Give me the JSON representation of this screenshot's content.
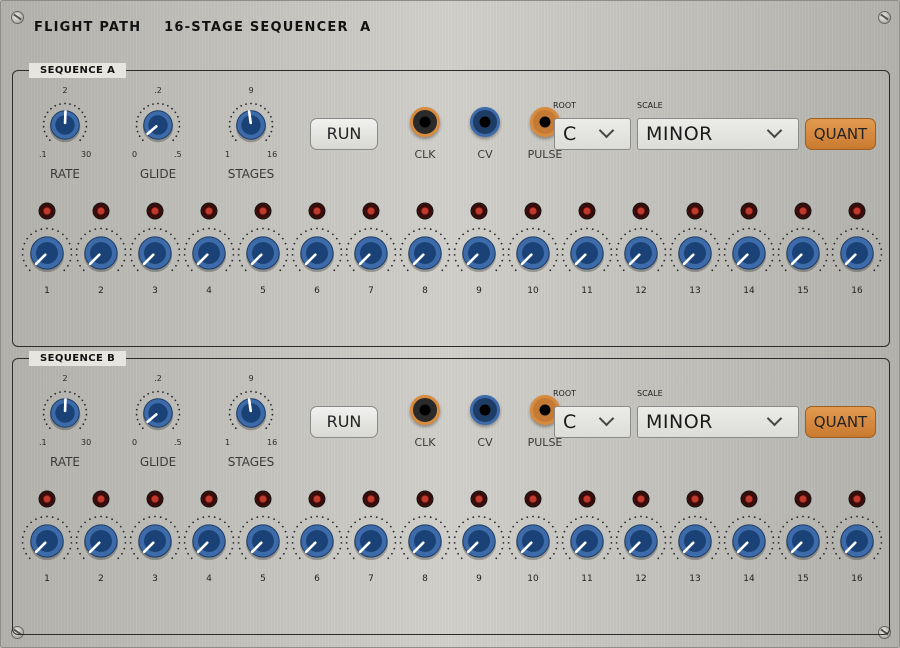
{
  "panel": {
    "title": "FLIGHT PATH    16-STAGE SEQUENCER  A"
  },
  "colors": {
    "knob": "#3d6aa8",
    "knob_dark": "#1b4276",
    "jack_orange": "#d88b3e",
    "quant": "#d88b3e",
    "led": "#c23a2e"
  },
  "sequences": [
    {
      "label": "SEQUENCE A",
      "controls": {
        "rate": {
          "label": "RATE",
          "top": "2",
          "min": ".1",
          "max": "30"
        },
        "glide": {
          "label": "GLIDE",
          "top": ".2",
          "min": "0",
          "max": ".5"
        },
        "stages": {
          "label": "STAGES",
          "top": "9",
          "min": "1",
          "max": "16"
        }
      },
      "run_label": "RUN",
      "jacks": [
        {
          "label": "CLK"
        },
        {
          "label": "CV"
        },
        {
          "label": "PULSE"
        }
      ],
      "root": {
        "label": "ROOT",
        "value": "C"
      },
      "scale": {
        "label": "SCALE",
        "value": "MINOR"
      },
      "quant_label": "QUANT",
      "steps": [
        "1",
        "2",
        "3",
        "4",
        "5",
        "6",
        "7",
        "8",
        "9",
        "10",
        "11",
        "12",
        "13",
        "14",
        "15",
        "16"
      ]
    },
    {
      "label": "SEQUENCE B",
      "controls": {
        "rate": {
          "label": "RATE",
          "top": "2",
          "min": ".1",
          "max": "30"
        },
        "glide": {
          "label": "GLIDE",
          "top": ".2",
          "min": "0",
          "max": ".5"
        },
        "stages": {
          "label": "STAGES",
          "top": "9",
          "min": "1",
          "max": "16"
        }
      },
      "run_label": "RUN",
      "jacks": [
        {
          "label": "CLK"
        },
        {
          "label": "CV"
        },
        {
          "label": "PULSE"
        }
      ],
      "root": {
        "label": "ROOT",
        "value": "C"
      },
      "scale": {
        "label": "SCALE",
        "value": "MINOR"
      },
      "quant_label": "QUANT",
      "steps": [
        "1",
        "2",
        "3",
        "4",
        "5",
        "6",
        "7",
        "8",
        "9",
        "10",
        "11",
        "12",
        "13",
        "14",
        "15",
        "16"
      ]
    }
  ]
}
